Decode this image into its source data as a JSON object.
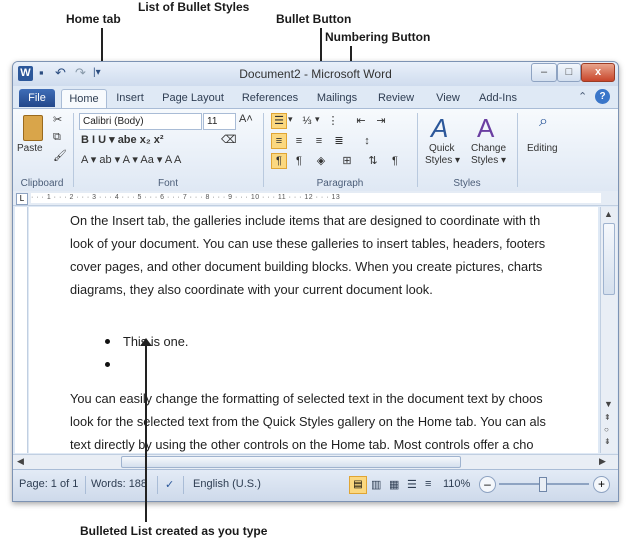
{
  "callouts": {
    "home_tab": "Home tab",
    "bullet_styles": "List of Bullet Styles",
    "bullet_button": "Bullet Button",
    "numbering_button": "Numbering Button",
    "bulleted_list": "Bulleted List created as you type"
  },
  "window": {
    "title": "Document2 - Microsoft Word",
    "app_icon": "W",
    "minimize": "–",
    "maximize": "□",
    "close": "x"
  },
  "tabs": [
    "File",
    "Home",
    "Insert",
    "Page Layout",
    "References",
    "Mailings",
    "Review",
    "View",
    "Add-Ins"
  ],
  "ribbon": {
    "clipboard": {
      "paste": "Paste",
      "label": "Clipboard"
    },
    "font": {
      "name": "Calibri (Body)",
      "size": "11",
      "label": "Font",
      "row2": "B  I  U ▾ abe x₂ x²",
      "row3": "A ▾  ab ▾  A ▾  Aa ▾   A  A"
    },
    "paragraph": {
      "label": "Paragraph"
    },
    "styles": {
      "quick": "Quick",
      "quick2": "Styles ▾",
      "change": "Change",
      "change2": "Styles ▾",
      "label": "Styles"
    },
    "editing": {
      "label": "Editing"
    }
  },
  "document": {
    "para1": [
      "On the Insert tab, the galleries include items that are designed to coordinate with th",
      "look of your document. You can use these galleries to insert tables, headers, footers",
      "cover pages, and other document building blocks. When you create pictures, charts",
      "diagrams, they also coordinate with your current document look."
    ],
    "bullets": [
      "This is one.",
      ""
    ],
    "para2": [
      "You can easily change the formatting of selected text in the document text by choos",
      "look for the selected text from the Quick Styles gallery on the Home tab. You can als",
      "text directly by using the other controls on the Home tab. Most controls offer a cho"
    ]
  },
  "status": {
    "page": "Page: 1 of 1",
    "words": "Words: 188",
    "language": "English (U.S.)",
    "zoom": "110%"
  },
  "colors": {
    "file_tab": "#2b579a",
    "highlight": "#fbd880"
  }
}
